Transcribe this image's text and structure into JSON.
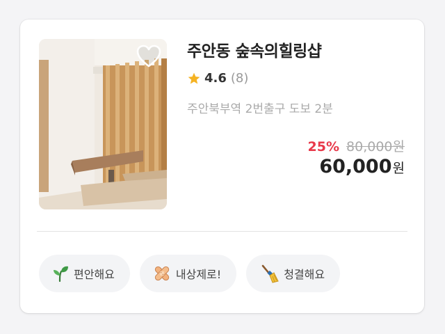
{
  "listing": {
    "title": "주안동 숲속의힐링샵",
    "rating": "4.6",
    "review_count": "(8)",
    "location": "주안북부역 2번출구 도보 2분",
    "discount": "25%",
    "original_price": "80,000원",
    "price": "60,000",
    "price_unit": "원",
    "favorited": false
  },
  "tags": [
    {
      "label": "편안해요",
      "icon": "sprout-icon"
    },
    {
      "label": "내상제로!",
      "icon": "bandage-icon"
    },
    {
      "label": "청결해요",
      "icon": "broom-icon"
    }
  ],
  "colors": {
    "discount": "#e8394a",
    "star": "#f5b323",
    "text": "#222222",
    "muted": "#aaaaaa"
  }
}
